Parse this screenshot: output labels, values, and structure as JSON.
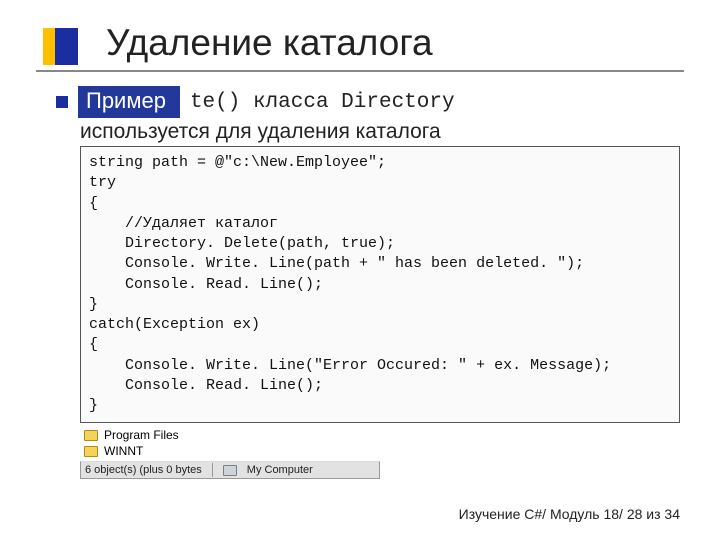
{
  "title": "Удаление каталога",
  "example_label": "Пример",
  "partial_after": "te() класса Directory",
  "sub_text": "используется для удаления каталога",
  "code": "string path = @\"c:\\New.Employee\";\ntry\n{\n    //Удаляет каталог\n    Directory. Delete(path, true);\n    Console. Write. Line(path + \" has been deleted. \");\n    Console. Read. Line();\n}\ncatch(Exception ex)\n{\n    Console. Write. Line(\"Error Occured: \" + ex. Message);\n    Console. Read. Line();\n}",
  "explorer": {
    "row1": "Program Files",
    "row2": "WINNT",
    "status_left": "6 object(s) (plus 0 bytes",
    "status_right": "My Computer"
  },
  "footer": "Изучение C#/ Модуль 18/ 28 из 34"
}
